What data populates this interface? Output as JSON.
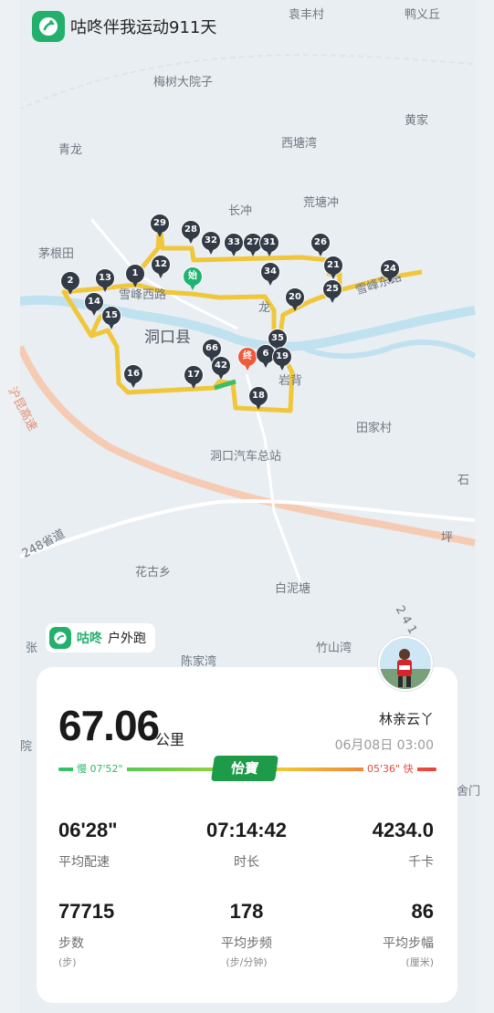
{
  "app": {
    "title": "咕咚伴我运动911天",
    "logo_icon": "codoon-runner-icon"
  },
  "map": {
    "places": [
      "袁丰村",
      "鸭义丘",
      "梅树大院子",
      "黄家",
      "青龙",
      "西塘湾",
      "长冲",
      "荒塘冲",
      "茅根田",
      "雪峰西路",
      "雪峰东路",
      "龙",
      "洞口县",
      "岩背",
      "田家村",
      "洞口汽车总站",
      "花古乡",
      "白泥塘",
      "竹山湾",
      "陈家湾",
      "石",
      "沪昆高速",
      "248省道",
      "坪",
      "张",
      "院",
      "舍门",
      "2 4 1"
    ],
    "markers": [
      "29",
      "28",
      "32",
      "33",
      "27",
      "31",
      "26",
      "21",
      "24",
      "2",
      "13",
      "1",
      "12",
      "始",
      "34",
      "25",
      "20",
      "14",
      "15",
      "35",
      "66",
      "终",
      "6",
      "19",
      "42",
      "16",
      "17",
      "18"
    ],
    "colors": {
      "route": "#f0c73a",
      "marker": "#333b46",
      "start": "#1fb371",
      "end": "#ef5a3c",
      "highway": "#f6cbb4"
    }
  },
  "activity_tag": {
    "brand": "咕咚",
    "type": "户外跑"
  },
  "summary": {
    "distance": "67.06",
    "distance_unit": "公里",
    "user_name": "林亲云丫",
    "date": "06月08日 03:00",
    "pace_slow": "慢 07'52\"",
    "pace_fast": "05'36\" 快",
    "sponsor": "怡寶"
  },
  "stats": [
    {
      "value": "06'28\"",
      "label": "平均配速",
      "sub": ""
    },
    {
      "value": "07:14:42",
      "label": "时长",
      "sub": ""
    },
    {
      "value": "4234.0",
      "label": "千卡",
      "sub": ""
    },
    {
      "value": "77715",
      "label": "步数",
      "sub": "(步)"
    },
    {
      "value": "178",
      "label": "平均步频",
      "sub": "(步/分钟)"
    },
    {
      "value": "86",
      "label": "平均步幅",
      "sub": "(厘米)"
    }
  ]
}
